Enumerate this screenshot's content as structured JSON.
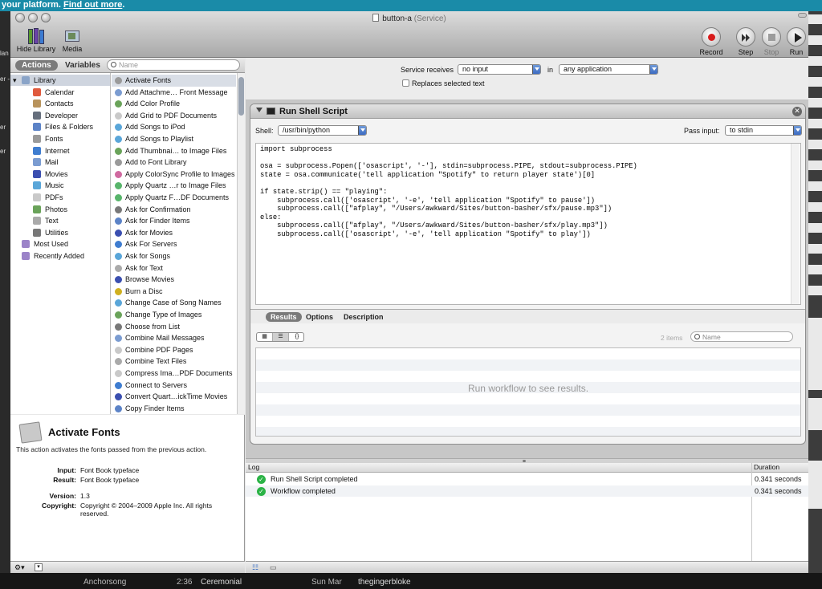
{
  "banner": {
    "text": "your platform. ",
    "link": "Find out more",
    "suffix": "."
  },
  "background": {
    "left_labels": [
      "lan",
      "er -",
      "er",
      "er"
    ],
    "bottom": [
      "Anchorsong",
      "2:36",
      "Ceremonial",
      "Sun Mar",
      "thegingerbloke"
    ]
  },
  "window": {
    "title": "button-a",
    "title_suffix": "(Service)",
    "toolbar": {
      "hide_library": "Hide Library",
      "media": "Media",
      "record": "Record",
      "step": "Step",
      "stop": "Stop",
      "run": "Run"
    }
  },
  "library": {
    "tabs": {
      "actions": "Actions",
      "variables": "Variables"
    },
    "search_placeholder": "Name",
    "categories": [
      {
        "label": "Library",
        "color": "#8aa4c8"
      },
      {
        "label": "Calendar",
        "color": "#e05a3d"
      },
      {
        "label": "Contacts",
        "color": "#b8935c"
      },
      {
        "label": "Developer",
        "color": "#666f7d"
      },
      {
        "label": "Files & Folders",
        "color": "#5c83c7"
      },
      {
        "label": "Fonts",
        "color": "#9a9a9a"
      },
      {
        "label": "Internet",
        "color": "#3f7dd0"
      },
      {
        "label": "Mail",
        "color": "#7b9cd1"
      },
      {
        "label": "Movies",
        "color": "#3b4fb0"
      },
      {
        "label": "Music",
        "color": "#5aa6d9"
      },
      {
        "label": "PDFs",
        "color": "#c9c9c9"
      },
      {
        "label": "Photos",
        "color": "#6aa35a"
      },
      {
        "label": "Text",
        "color": "#aaaaaa"
      },
      {
        "label": "Utilities",
        "color": "#787878"
      },
      {
        "label": "Most Used",
        "color": "#9b83c8"
      },
      {
        "label": "Recently Added",
        "color": "#9b83c8"
      }
    ],
    "actions": [
      {
        "label": "Activate Fonts",
        "color": "#9a9a9a"
      },
      {
        "label": "Add Attachme… Front Message",
        "color": "#7b9cd1"
      },
      {
        "label": "Add Color Profile",
        "color": "#6aa35a"
      },
      {
        "label": "Add Grid to PDF Documents",
        "color": "#c9c9c9"
      },
      {
        "label": "Add Songs to iPod",
        "color": "#5aa6d9"
      },
      {
        "label": "Add Songs to Playlist",
        "color": "#5aa6d9"
      },
      {
        "label": "Add Thumbnai… to Image Files",
        "color": "#6aa35a"
      },
      {
        "label": "Add to Font Library",
        "color": "#9a9a9a"
      },
      {
        "label": "Apply ColorSync Profile to Images",
        "color": "#d06aa0"
      },
      {
        "label": "Apply Quartz …r to Image Files",
        "color": "#58b56b"
      },
      {
        "label": "Apply Quartz F…DF Documents",
        "color": "#58b56b"
      },
      {
        "label": "Ask for Confirmation",
        "color": "#787878"
      },
      {
        "label": "Ask for Finder Items",
        "color": "#5c83c7"
      },
      {
        "label": "Ask for Movies",
        "color": "#3b4fb0"
      },
      {
        "label": "Ask For Servers",
        "color": "#3f7dd0"
      },
      {
        "label": "Ask for Songs",
        "color": "#5aa6d9"
      },
      {
        "label": "Ask for Text",
        "color": "#aaaaaa"
      },
      {
        "label": "Browse Movies",
        "color": "#3b4fb0"
      },
      {
        "label": "Burn a Disc",
        "color": "#d0b020"
      },
      {
        "label": "Change Case of Song Names",
        "color": "#5aa6d9"
      },
      {
        "label": "Change Type of Images",
        "color": "#6aa35a"
      },
      {
        "label": "Choose from List",
        "color": "#787878"
      },
      {
        "label": "Combine Mail Messages",
        "color": "#7b9cd1"
      },
      {
        "label": "Combine PDF Pages",
        "color": "#c9c9c9"
      },
      {
        "label": "Combine Text Files",
        "color": "#aaaaaa"
      },
      {
        "label": "Compress Ima…PDF Documents",
        "color": "#c9c9c9"
      },
      {
        "label": "Connect to Servers",
        "color": "#3f7dd0"
      },
      {
        "label": "Convert Quart…ickTime Movies",
        "color": "#3b4fb0"
      },
      {
        "label": "Copy Finder Items",
        "color": "#5c83c7"
      }
    ]
  },
  "description": {
    "title": "Activate Fonts",
    "text": "This action activates the fonts passed from the previous action.",
    "rows": [
      {
        "key": "Input:",
        "value": "Font Book typeface"
      },
      {
        "key": "Result:",
        "value": "Font Book typeface"
      },
      {
        "key": "Version:",
        "value": "1.3"
      },
      {
        "key": "Copyright:",
        "value": "Copyright © 2004–2009 Apple Inc. All rights reserved."
      }
    ]
  },
  "service": {
    "receives_label": "Service receives",
    "receives_value": "no input",
    "in_label": "in",
    "app_value": "any application",
    "replaces_label": "Replaces selected text"
  },
  "action": {
    "title": "Run Shell Script",
    "shell_label": "Shell:",
    "shell_value": "/usr/bin/python",
    "pass_label": "Pass input:",
    "pass_value": "to stdin",
    "code": "import subprocess\n\nosa = subprocess.Popen(['osascript', '-'], stdin=subprocess.PIPE, stdout=subprocess.PIPE)\nstate = osa.communicate('tell application \"Spotify\" to return player state')[0]\n\nif state.strip() == \"playing\":\n    subprocess.call(['osascript', '-e', 'tell application \"Spotify\" to pause'])\n    subprocess.call([\"afplay\", \"/Users/awkward/Sites/button-basher/sfx/pause.mp3\"])\nelse:\n    subprocess.call([\"afplay\", \"/Users/awkward/Sites/button-basher/sfx/play.mp3\"])\n    subprocess.call(['osascript', '-e', 'tell application \"Spotify\" to play'])",
    "tabs": {
      "results": "Results",
      "options": "Options",
      "description": "Description"
    },
    "items_count": "2 items",
    "results_search_placeholder": "Name",
    "run_message": "Run workflow to see results."
  },
  "log": {
    "header_log": "Log",
    "header_duration": "Duration",
    "rows": [
      {
        "message": "Run Shell Script completed",
        "duration": "0.341 seconds"
      },
      {
        "message": "Workflow completed",
        "duration": "0.341 seconds"
      }
    ]
  }
}
